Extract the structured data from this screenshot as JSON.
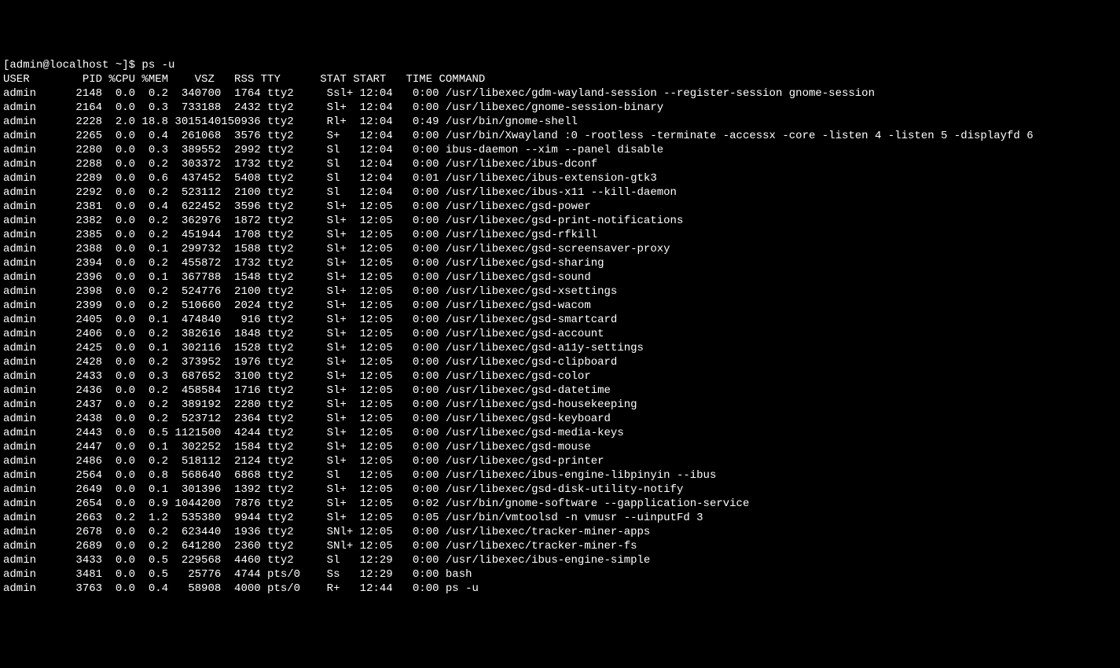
{
  "prompt": "[admin@localhost ~]$ ",
  "command": "ps -u",
  "header": "USER        PID %CPU %MEM    VSZ   RSS TTY      STAT START   TIME COMMAND",
  "processes": [
    {
      "user": "admin",
      "pid": "2148",
      "cpu": "0.0",
      "mem": "0.2",
      "vsz": "340700",
      "rss": "1764",
      "tty": "tty2",
      "stat": "Ssl+",
      "start": "12:04",
      "time": "0:00",
      "cmd": "/usr/libexec/gdm-wayland-session --register-session gnome-session"
    },
    {
      "user": "admin",
      "pid": "2164",
      "cpu": "0.0",
      "mem": "0.3",
      "vsz": "733188",
      "rss": "2432",
      "tty": "tty2",
      "stat": "Sl+",
      "start": "12:04",
      "time": "0:00",
      "cmd": "/usr/libexec/gnome-session-binary"
    },
    {
      "user": "admin",
      "pid": "2228",
      "cpu": "2.0",
      "mem": "18.8",
      "vsz": "3015140",
      "rss": "150936",
      "tty": "tty2",
      "stat": "Rl+",
      "start": "12:04",
      "time": "0:49",
      "cmd": "/usr/bin/gnome-shell"
    },
    {
      "user": "admin",
      "pid": "2265",
      "cpu": "0.0",
      "mem": "0.4",
      "vsz": "261068",
      "rss": "3576",
      "tty": "tty2",
      "stat": "S+",
      "start": "12:04",
      "time": "0:00",
      "cmd": "/usr/bin/Xwayland :0 -rootless -terminate -accessx -core -listen 4 -listen 5 -displayfd 6"
    },
    {
      "user": "admin",
      "pid": "2280",
      "cpu": "0.0",
      "mem": "0.3",
      "vsz": "389552",
      "rss": "2992",
      "tty": "tty2",
      "stat": "Sl",
      "start": "12:04",
      "time": "0:00",
      "cmd": "ibus-daemon --xim --panel disable"
    },
    {
      "user": "admin",
      "pid": "2288",
      "cpu": "0.0",
      "mem": "0.2",
      "vsz": "303372",
      "rss": "1732",
      "tty": "tty2",
      "stat": "Sl",
      "start": "12:04",
      "time": "0:00",
      "cmd": "/usr/libexec/ibus-dconf"
    },
    {
      "user": "admin",
      "pid": "2289",
      "cpu": "0.0",
      "mem": "0.6",
      "vsz": "437452",
      "rss": "5408",
      "tty": "tty2",
      "stat": "Sl",
      "start": "12:04",
      "time": "0:01",
      "cmd": "/usr/libexec/ibus-extension-gtk3"
    },
    {
      "user": "admin",
      "pid": "2292",
      "cpu": "0.0",
      "mem": "0.2",
      "vsz": "523112",
      "rss": "2100",
      "tty": "tty2",
      "stat": "Sl",
      "start": "12:04",
      "time": "0:00",
      "cmd": "/usr/libexec/ibus-x11 --kill-daemon"
    },
    {
      "user": "admin",
      "pid": "2381",
      "cpu": "0.0",
      "mem": "0.4",
      "vsz": "622452",
      "rss": "3596",
      "tty": "tty2",
      "stat": "Sl+",
      "start": "12:05",
      "time": "0:00",
      "cmd": "/usr/libexec/gsd-power"
    },
    {
      "user": "admin",
      "pid": "2382",
      "cpu": "0.0",
      "mem": "0.2",
      "vsz": "362976",
      "rss": "1872",
      "tty": "tty2",
      "stat": "Sl+",
      "start": "12:05",
      "time": "0:00",
      "cmd": "/usr/libexec/gsd-print-notifications"
    },
    {
      "user": "admin",
      "pid": "2385",
      "cpu": "0.0",
      "mem": "0.2",
      "vsz": "451944",
      "rss": "1708",
      "tty": "tty2",
      "stat": "Sl+",
      "start": "12:05",
      "time": "0:00",
      "cmd": "/usr/libexec/gsd-rfkill"
    },
    {
      "user": "admin",
      "pid": "2388",
      "cpu": "0.0",
      "mem": "0.1",
      "vsz": "299732",
      "rss": "1588",
      "tty": "tty2",
      "stat": "Sl+",
      "start": "12:05",
      "time": "0:00",
      "cmd": "/usr/libexec/gsd-screensaver-proxy"
    },
    {
      "user": "admin",
      "pid": "2394",
      "cpu": "0.0",
      "mem": "0.2",
      "vsz": "455872",
      "rss": "1732",
      "tty": "tty2",
      "stat": "Sl+",
      "start": "12:05",
      "time": "0:00",
      "cmd": "/usr/libexec/gsd-sharing"
    },
    {
      "user": "admin",
      "pid": "2396",
      "cpu": "0.0",
      "mem": "0.1",
      "vsz": "367788",
      "rss": "1548",
      "tty": "tty2",
      "stat": "Sl+",
      "start": "12:05",
      "time": "0:00",
      "cmd": "/usr/libexec/gsd-sound"
    },
    {
      "user": "admin",
      "pid": "2398",
      "cpu": "0.0",
      "mem": "0.2",
      "vsz": "524776",
      "rss": "2100",
      "tty": "tty2",
      "stat": "Sl+",
      "start": "12:05",
      "time": "0:00",
      "cmd": "/usr/libexec/gsd-xsettings"
    },
    {
      "user": "admin",
      "pid": "2399",
      "cpu": "0.0",
      "mem": "0.2",
      "vsz": "510660",
      "rss": "2024",
      "tty": "tty2",
      "stat": "Sl+",
      "start": "12:05",
      "time": "0:00",
      "cmd": "/usr/libexec/gsd-wacom"
    },
    {
      "user": "admin",
      "pid": "2405",
      "cpu": "0.0",
      "mem": "0.1",
      "vsz": "474840",
      "rss": "916",
      "tty": "tty2",
      "stat": "Sl+",
      "start": "12:05",
      "time": "0:00",
      "cmd": "/usr/libexec/gsd-smartcard"
    },
    {
      "user": "admin",
      "pid": "2406",
      "cpu": "0.0",
      "mem": "0.2",
      "vsz": "382616",
      "rss": "1848",
      "tty": "tty2",
      "stat": "Sl+",
      "start": "12:05",
      "time": "0:00",
      "cmd": "/usr/libexec/gsd-account"
    },
    {
      "user": "admin",
      "pid": "2425",
      "cpu": "0.0",
      "mem": "0.1",
      "vsz": "302116",
      "rss": "1528",
      "tty": "tty2",
      "stat": "Sl+",
      "start": "12:05",
      "time": "0:00",
      "cmd": "/usr/libexec/gsd-a11y-settings"
    },
    {
      "user": "admin",
      "pid": "2428",
      "cpu": "0.0",
      "mem": "0.2",
      "vsz": "373952",
      "rss": "1976",
      "tty": "tty2",
      "stat": "Sl+",
      "start": "12:05",
      "time": "0:00",
      "cmd": "/usr/libexec/gsd-clipboard"
    },
    {
      "user": "admin",
      "pid": "2433",
      "cpu": "0.0",
      "mem": "0.3",
      "vsz": "687652",
      "rss": "3100",
      "tty": "tty2",
      "stat": "Sl+",
      "start": "12:05",
      "time": "0:00",
      "cmd": "/usr/libexec/gsd-color"
    },
    {
      "user": "admin",
      "pid": "2436",
      "cpu": "0.0",
      "mem": "0.2",
      "vsz": "458584",
      "rss": "1716",
      "tty": "tty2",
      "stat": "Sl+",
      "start": "12:05",
      "time": "0:00",
      "cmd": "/usr/libexec/gsd-datetime"
    },
    {
      "user": "admin",
      "pid": "2437",
      "cpu": "0.0",
      "mem": "0.2",
      "vsz": "389192",
      "rss": "2280",
      "tty": "tty2",
      "stat": "Sl+",
      "start": "12:05",
      "time": "0:00",
      "cmd": "/usr/libexec/gsd-housekeeping"
    },
    {
      "user": "admin",
      "pid": "2438",
      "cpu": "0.0",
      "mem": "0.2",
      "vsz": "523712",
      "rss": "2364",
      "tty": "tty2",
      "stat": "Sl+",
      "start": "12:05",
      "time": "0:00",
      "cmd": "/usr/libexec/gsd-keyboard"
    },
    {
      "user": "admin",
      "pid": "2443",
      "cpu": "0.0",
      "mem": "0.5",
      "vsz": "1121500",
      "rss": "4244",
      "tty": "tty2",
      "stat": "Sl+",
      "start": "12:05",
      "time": "0:00",
      "cmd": "/usr/libexec/gsd-media-keys"
    },
    {
      "user": "admin",
      "pid": "2447",
      "cpu": "0.0",
      "mem": "0.1",
      "vsz": "302252",
      "rss": "1584",
      "tty": "tty2",
      "stat": "Sl+",
      "start": "12:05",
      "time": "0:00",
      "cmd": "/usr/libexec/gsd-mouse"
    },
    {
      "user": "admin",
      "pid": "2486",
      "cpu": "0.0",
      "mem": "0.2",
      "vsz": "518112",
      "rss": "2124",
      "tty": "tty2",
      "stat": "Sl+",
      "start": "12:05",
      "time": "0:00",
      "cmd": "/usr/libexec/gsd-printer"
    },
    {
      "user": "admin",
      "pid": "2564",
      "cpu": "0.0",
      "mem": "0.8",
      "vsz": "568640",
      "rss": "6868",
      "tty": "tty2",
      "stat": "Sl",
      "start": "12:05",
      "time": "0:00",
      "cmd": "/usr/libexec/ibus-engine-libpinyin --ibus"
    },
    {
      "user": "admin",
      "pid": "2649",
      "cpu": "0.0",
      "mem": "0.1",
      "vsz": "301396",
      "rss": "1392",
      "tty": "tty2",
      "stat": "Sl+",
      "start": "12:05",
      "time": "0:00",
      "cmd": "/usr/libexec/gsd-disk-utility-notify"
    },
    {
      "user": "admin",
      "pid": "2654",
      "cpu": "0.0",
      "mem": "0.9",
      "vsz": "1044200",
      "rss": "7876",
      "tty": "tty2",
      "stat": "Sl+",
      "start": "12:05",
      "time": "0:02",
      "cmd": "/usr/bin/gnome-software --gapplication-service"
    },
    {
      "user": "admin",
      "pid": "2663",
      "cpu": "0.2",
      "mem": "1.2",
      "vsz": "535380",
      "rss": "9944",
      "tty": "tty2",
      "stat": "Sl+",
      "start": "12:05",
      "time": "0:05",
      "cmd": "/usr/bin/vmtoolsd -n vmusr --uinputFd 3"
    },
    {
      "user": "admin",
      "pid": "2678",
      "cpu": "0.0",
      "mem": "0.2",
      "vsz": "623440",
      "rss": "1936",
      "tty": "tty2",
      "stat": "SNl+",
      "start": "12:05",
      "time": "0:00",
      "cmd": "/usr/libexec/tracker-miner-apps"
    },
    {
      "user": "admin",
      "pid": "2689",
      "cpu": "0.0",
      "mem": "0.2",
      "vsz": "641280",
      "rss": "2360",
      "tty": "tty2",
      "stat": "SNl+",
      "start": "12:05",
      "time": "0:00",
      "cmd": "/usr/libexec/tracker-miner-fs"
    },
    {
      "user": "admin",
      "pid": "3433",
      "cpu": "0.0",
      "mem": "0.5",
      "vsz": "229568",
      "rss": "4460",
      "tty": "tty2",
      "stat": "Sl",
      "start": "12:29",
      "time": "0:00",
      "cmd": "/usr/libexec/ibus-engine-simple"
    },
    {
      "user": "admin",
      "pid": "3481",
      "cpu": "0.0",
      "mem": "0.5",
      "vsz": "25776",
      "rss": "4744",
      "tty": "pts/0",
      "stat": "Ss",
      "start": "12:29",
      "time": "0:00",
      "cmd": "bash"
    },
    {
      "user": "admin",
      "pid": "3763",
      "cpu": "0.0",
      "mem": "0.4",
      "vsz": "58908",
      "rss": "4000",
      "tty": "pts/0",
      "stat": "R+",
      "start": "12:44",
      "time": "0:00",
      "cmd": "ps -u"
    }
  ]
}
